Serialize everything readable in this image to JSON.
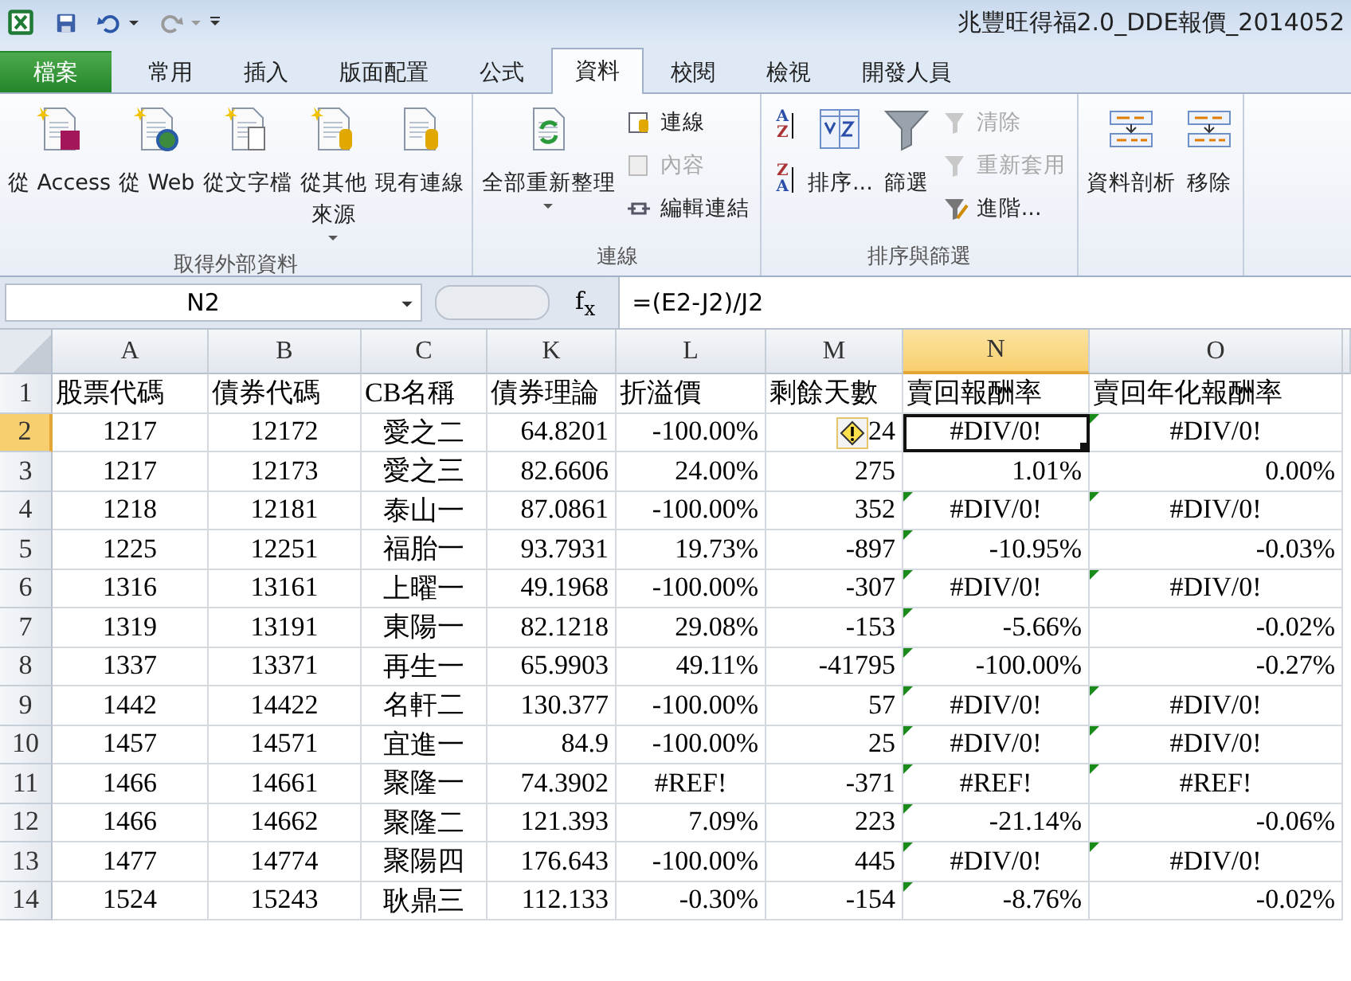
{
  "title_bar": {
    "title": "兆豐旺得福2.0_DDE報價_2014052"
  },
  "tabs": [
    {
      "label": "檔案",
      "kind": "file",
      "selected": false
    },
    {
      "label": "常用",
      "kind": "tab",
      "selected": false
    },
    {
      "label": "插入",
      "kind": "tab",
      "selected": false
    },
    {
      "label": "版面配置",
      "kind": "tab",
      "selected": false
    },
    {
      "label": "公式",
      "kind": "tab",
      "selected": false
    },
    {
      "label": "資料",
      "kind": "tab",
      "selected": true
    },
    {
      "label": "校閱",
      "kind": "tab",
      "selected": false
    },
    {
      "label": "檢視",
      "kind": "tab",
      "selected": false
    },
    {
      "label": "開發人員",
      "kind": "tab",
      "selected": false
    }
  ],
  "ribbon": {
    "groups": [
      {
        "label": "取得外部資料",
        "items": [
          {
            "kind": "large",
            "label": "從 Access",
            "dropdown": false
          },
          {
            "kind": "large",
            "label": "從 Web",
            "dropdown": false
          },
          {
            "kind": "large",
            "label": "從文字檔",
            "dropdown": false
          },
          {
            "kind": "large",
            "lines": [
              "從其他",
              "來源"
            ],
            "dropdown": true
          },
          {
            "kind": "large",
            "label": "現有連線",
            "dropdown": false
          }
        ]
      },
      {
        "label": "連線",
        "items": [
          {
            "kind": "large",
            "label": "全部重新整理",
            "dropdown": true
          },
          {
            "kind": "stack",
            "items": [
              {
                "label": "連線",
                "disabled": false
              },
              {
                "label": "內容",
                "disabled": true
              },
              {
                "label": "編輯連結",
                "disabled": false
              }
            ]
          }
        ]
      },
      {
        "label": "排序與篩選",
        "items": [
          {
            "kind": "sortpair",
            "buttons": [
              {
                "top": "A",
                "bottom": "Z"
              },
              {
                "top": "Z",
                "bottom": "A"
              }
            ]
          },
          {
            "kind": "large",
            "label": "排序...",
            "dropdown": false
          },
          {
            "kind": "large",
            "label": "篩選",
            "dropdown": false
          },
          {
            "kind": "stack",
            "items": [
              {
                "label": "清除",
                "disabled": true
              },
              {
                "label": "重新套用",
                "disabled": true
              },
              {
                "label": "進階...",
                "disabled": false
              }
            ]
          }
        ]
      },
      {
        "items": [
          {
            "kind": "large",
            "label": "資料剖析",
            "dropdown": false
          },
          {
            "kind": "large",
            "label": "移除",
            "dropdown": false
          }
        ]
      }
    ]
  },
  "formula_bar": {
    "name_box": "N2",
    "function_label": "f$_{x}$",
    "formula": "=(E2-J2)/J2"
  },
  "grid": {
    "columns": [
      {
        "label": "A",
        "selected": false
      },
      {
        "label": "B",
        "selected": false
      },
      {
        "label": "C",
        "selected": false
      },
      {
        "label": "K",
        "selected": false
      },
      {
        "label": "L",
        "selected": false
      },
      {
        "label": "M",
        "selected": false
      },
      {
        "label": "N",
        "selected": true
      },
      {
        "label": "O",
        "selected": false
      }
    ],
    "rows": [
      {
        "num": "1",
        "kind": "header",
        "selected": false,
        "cells": [
          "股票代碼",
          "債券代碼",
          "CB名稱",
          "債券理論",
          "折溢價",
          "剩餘天數",
          "賣回報酬率",
          "賣回年化報酬率"
        ]
      },
      {
        "num": "2",
        "kind": "data",
        "selected": true,
        "cells": [
          "1217",
          "12172",
          "愛之二",
          "64.8201",
          "-100.00%",
          {
            "t": "24",
            "kind": "number",
            "warning_tag": true
          },
          {
            "t": "#DIV/0!",
            "kind": "error",
            "flag": false
          },
          {
            "t": "#DIV/0!",
            "kind": "error",
            "flag": true
          }
        ]
      },
      {
        "num": "3",
        "kind": "data",
        "selected": false,
        "cells": [
          "1217",
          "12173",
          "愛之三",
          "82.6606",
          "24.00%",
          "275",
          {
            "t": "1.01%",
            "kind": "number",
            "flag": false
          },
          {
            "t": "0.00%",
            "kind": "number",
            "flag": false
          }
        ]
      },
      {
        "num": "4",
        "kind": "data",
        "selected": false,
        "cells": [
          "1218",
          "12181",
          "泰山一",
          "87.0861",
          "-100.00%",
          "352",
          {
            "t": "#DIV/0!",
            "kind": "error",
            "flag": true
          },
          {
            "t": "#DIV/0!",
            "kind": "error",
            "flag": true
          }
        ]
      },
      {
        "num": "5",
        "kind": "data",
        "selected": false,
        "cells": [
          "1225",
          "12251",
          "福胎一",
          "93.7931",
          "19.73%",
          "-897",
          {
            "t": "-10.95%",
            "kind": "number",
            "flag": true
          },
          {
            "t": "-0.03%",
            "kind": "number",
            "flag": false
          }
        ]
      },
      {
        "num": "6",
        "kind": "data",
        "selected": false,
        "cells": [
          "1316",
          "13161",
          "上曜一",
          "49.1968",
          "-100.00%",
          "-307",
          {
            "t": "#DIV/0!",
            "kind": "error",
            "flag": true
          },
          {
            "t": "#DIV/0!",
            "kind": "error",
            "flag": true
          }
        ]
      },
      {
        "num": "7",
        "kind": "data",
        "selected": false,
        "cells": [
          "1319",
          "13191",
          "東陽一",
          "82.1218",
          "29.08%",
          "-153",
          {
            "t": "-5.66%",
            "kind": "number",
            "flag": true
          },
          {
            "t": "-0.02%",
            "kind": "number",
            "flag": false
          }
        ]
      },
      {
        "num": "8",
        "kind": "data",
        "selected": false,
        "cells": [
          "1337",
          "13371",
          "再生一",
          "65.9903",
          "49.11%",
          "-41795",
          {
            "t": "-100.00%",
            "kind": "number",
            "flag": true
          },
          {
            "t": "-0.27%",
            "kind": "number",
            "flag": false
          }
        ]
      },
      {
        "num": "9",
        "kind": "data",
        "selected": false,
        "cells": [
          "1442",
          "14422",
          "名軒二",
          "130.377",
          "-100.00%",
          "57",
          {
            "t": "#DIV/0!",
            "kind": "error",
            "flag": true
          },
          {
            "t": "#DIV/0!",
            "kind": "error",
            "flag": true
          }
        ]
      },
      {
        "num": "10",
        "kind": "data",
        "selected": false,
        "cells": [
          "1457",
          "14571",
          "宜進一",
          "84.9",
          "-100.00%",
          "25",
          {
            "t": "#DIV/0!",
            "kind": "error",
            "flag": true
          },
          {
            "t": "#DIV/0!",
            "kind": "error",
            "flag": true
          }
        ]
      },
      {
        "num": "11",
        "kind": "data",
        "selected": false,
        "cells": [
          "1466",
          "14661",
          "聚隆一",
          "74.3902",
          {
            "t": "#REF!",
            "kind": "error"
          },
          "-371",
          {
            "t": "#REF!",
            "kind": "error",
            "flag": true
          },
          {
            "t": "#REF!",
            "kind": "error",
            "flag": true
          }
        ]
      },
      {
        "num": "12",
        "kind": "data",
        "selected": false,
        "cells": [
          "1466",
          "14662",
          "聚隆二",
          "121.393",
          "7.09%",
          "223",
          {
            "t": "-21.14%",
            "kind": "number",
            "flag": true
          },
          {
            "t": "-0.06%",
            "kind": "number",
            "flag": false
          }
        ]
      },
      {
        "num": "13",
        "kind": "data",
        "selected": false,
        "cells": [
          "1477",
          "14774",
          "聚陽四",
          "176.643",
          "-100.00%",
          "445",
          {
            "t": "#DIV/0!",
            "kind": "error",
            "flag": true
          },
          {
            "t": "#DIV/0!",
            "kind": "error",
            "flag": true
          }
        ]
      },
      {
        "num": "14",
        "kind": "data",
        "selected": false,
        "cells": [
          "1524",
          "15243",
          "耿鼎三",
          "112.133",
          "-0.30%",
          "-154",
          {
            "t": "-8.76%",
            "kind": "number",
            "flag": true
          },
          {
            "t": "-0.02%",
            "kind": "number",
            "flag": false
          }
        ]
      }
    ]
  }
}
